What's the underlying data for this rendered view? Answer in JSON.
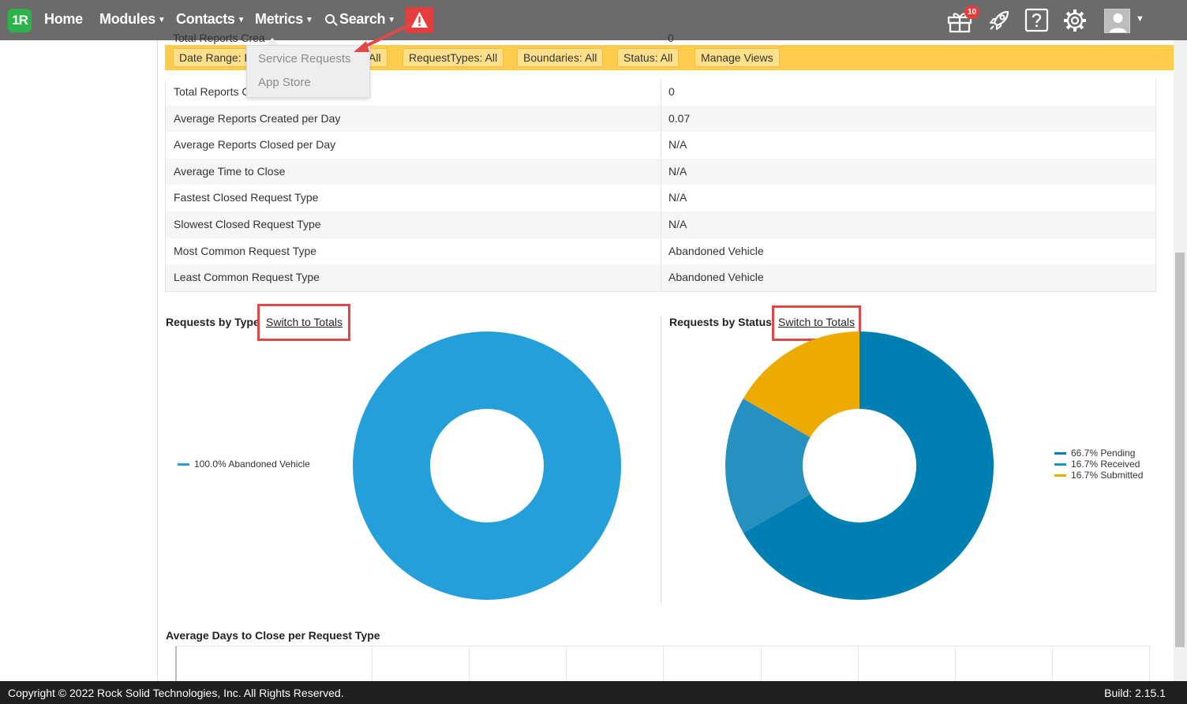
{
  "nav": {
    "logo": "1R",
    "home": "Home",
    "modules": "Modules",
    "contacts": "Contacts",
    "metrics": "Metrics",
    "search": "Search",
    "gift_badge": "10",
    "icons": [
      "warning-icon",
      "gift-icon",
      "rocket-icon",
      "help-icon",
      "gear-icon",
      "avatar"
    ]
  },
  "metrics_menu": {
    "items": [
      "Service Requests",
      "App Store"
    ]
  },
  "filters": {
    "date_range": "Date Range: L",
    "all_partial": "All",
    "request_types": "RequestTypes: All",
    "boundaries": "Boundaries: All",
    "status": "Status: All",
    "manage_views": "Manage Views"
  },
  "stats": {
    "cut_label": "Total Reports Crea",
    "cut_value": "0",
    "rows": [
      {
        "label": "Total Reports C",
        "value": "0"
      },
      {
        "label": "Average Reports Created per Day",
        "value": "0.07"
      },
      {
        "label": "Average Reports Closed per Day",
        "value": "N/A"
      },
      {
        "label": "Average Time to Close",
        "value": "N/A"
      },
      {
        "label": "Fastest Closed Request Type",
        "value": "N/A"
      },
      {
        "label": "Slowest Closed Request Type",
        "value": "N/A"
      },
      {
        "label": "Most Common Request Type",
        "value": "Abandoned Vehicle"
      },
      {
        "label": "Least Common Request Type",
        "value": "Abandoned Vehicle"
      }
    ]
  },
  "charts": {
    "by_type": {
      "title": "Requests by Type",
      "switch_label": "Switch to Totals",
      "legend": [
        {
          "label": "100.0% Abandoned Vehicle",
          "color": "#259fda"
        }
      ]
    },
    "by_status": {
      "title": "Requests by Status",
      "switch_label": "Switch to Totals",
      "legend": [
        {
          "label": "66.7% Pending",
          "color": "#0080b2"
        },
        {
          "label": "16.7% Received",
          "color": "#2691c1"
        },
        {
          "label": "16.7% Submitted",
          "color": "#edaa00"
        }
      ]
    },
    "avg_days_title": "Average Days to Close per Request Type"
  },
  "chart_data": [
    {
      "type": "pie",
      "categories": [
        "Abandoned Vehicle"
      ],
      "values": [
        100.0
      ],
      "colors": [
        "#259fda"
      ],
      "title": "Requests by Type"
    },
    {
      "type": "pie",
      "categories": [
        "Pending",
        "Received",
        "Submitted"
      ],
      "values": [
        66.7,
        16.7,
        16.7
      ],
      "colors": [
        "#0080b2",
        "#2691c1",
        "#edaa00"
      ],
      "title": "Requests by Status"
    }
  ],
  "footer": {
    "copyright": "Copyright © 2022 Rock Solid Technologies, Inc.   All Rights Reserved.",
    "build": "Build: 2.15.1"
  }
}
